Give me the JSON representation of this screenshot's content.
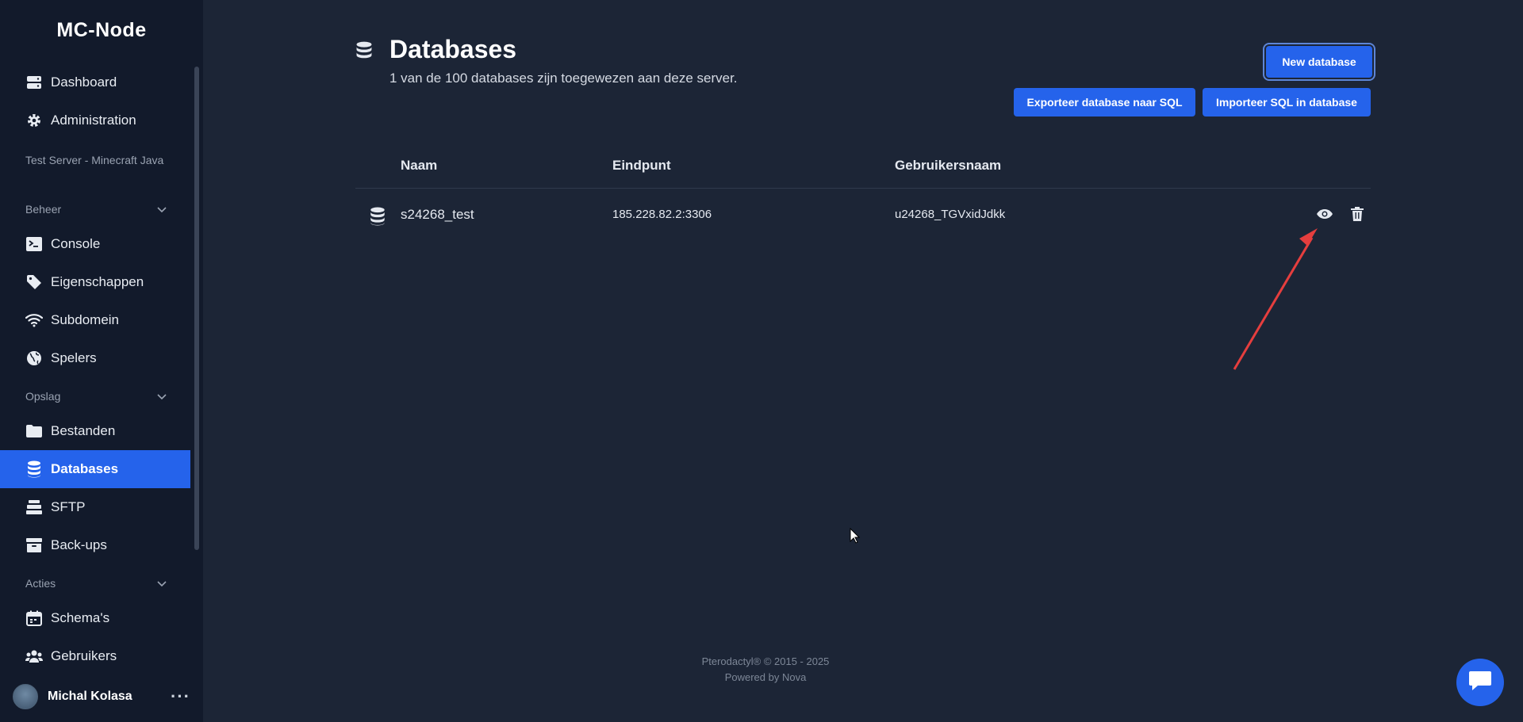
{
  "brand": "MC-Node",
  "nav_top": [
    {
      "label": "Dashboard",
      "icon": "server-stack-icon"
    },
    {
      "label": "Administration",
      "icon": "gear-icon"
    }
  ],
  "server_name": "Test Server - Minecraft Java",
  "sections": {
    "beheer": "Beheer",
    "opslag": "Opslag",
    "acties": "Acties"
  },
  "nav_beheer": [
    {
      "label": "Console",
      "icon": "terminal-icon"
    },
    {
      "label": "Eigenschappen",
      "icon": "tag-icon"
    },
    {
      "label": "Subdomein",
      "icon": "wifi-icon"
    },
    {
      "label": "Spelers",
      "icon": "globe-icon"
    }
  ],
  "nav_opslag": [
    {
      "label": "Bestanden",
      "icon": "folder-icon"
    },
    {
      "label": "Databases",
      "icon": "database-icon",
      "active": true
    },
    {
      "label": "SFTP",
      "icon": "layers-icon"
    },
    {
      "label": "Back-ups",
      "icon": "archive-icon"
    }
  ],
  "nav_acties": [
    {
      "label": "Schema's",
      "icon": "calendar-icon"
    },
    {
      "label": "Gebruikers",
      "icon": "users-icon"
    }
  ],
  "user": {
    "name": "Michal Kolasa",
    "more": "···"
  },
  "page": {
    "title": "Databases",
    "subtitle": "1 van de 100 databases zijn toegewezen aan deze server."
  },
  "buttons": {
    "new_database": "New database",
    "export": "Exporteer database naar SQL",
    "import": "Importeer SQL in database"
  },
  "table": {
    "headers": [
      "Naam",
      "Eindpunt",
      "Gebruikersnaam"
    ],
    "rows": [
      {
        "name": "s24268_test",
        "endpoint": "185.228.82.2:3306",
        "username": "u24268_TGVxidJdkk"
      }
    ]
  },
  "footer": {
    "line1": "Pterodactyl® © 2015 - 2025",
    "line2": "Powered by Nova"
  },
  "colors": {
    "accent": "#2563eb",
    "sidebar": "#121a2b",
    "background": "#1c2536",
    "annotation_arrow": "#e53e3e"
  }
}
